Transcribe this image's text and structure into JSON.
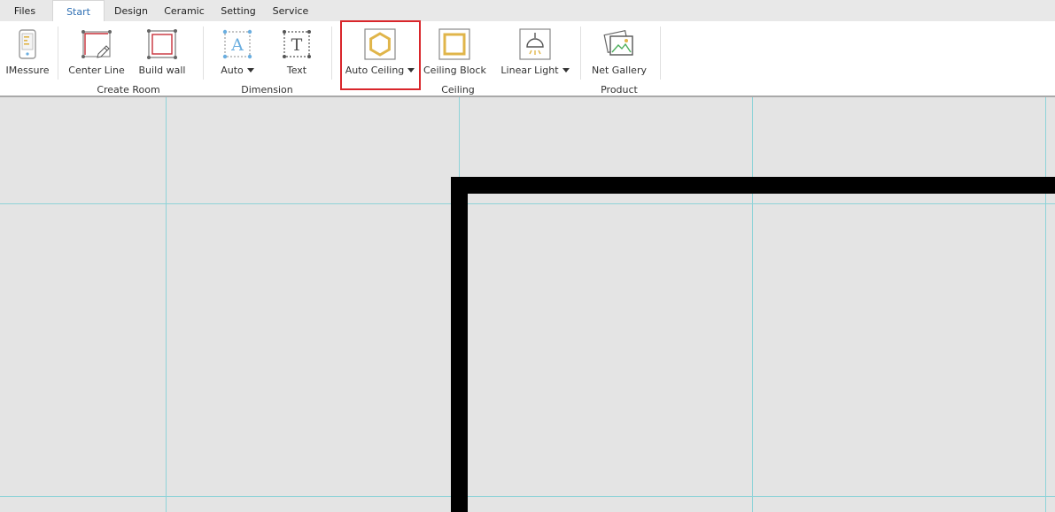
{
  "tabs": [
    {
      "label": "Files",
      "active": false
    },
    {
      "label": "Start",
      "active": true
    },
    {
      "label": "Design",
      "active": false
    },
    {
      "label": "Ceramic",
      "active": false
    },
    {
      "label": "Setting",
      "active": false
    },
    {
      "label": "Service",
      "active": false
    }
  ],
  "ribbon": {
    "tools": {
      "imessure": "IMessure",
      "center_line": "Center Line",
      "build_wall": "Build wall",
      "auto": "Auto",
      "text": "Text",
      "auto_ceiling": "Auto Ceiling",
      "ceiling_block": "Ceiling Block",
      "linear_light": "Linear Light",
      "net_gallery": "Net Gallery"
    },
    "groups": {
      "create_room": "Create Room",
      "dimension": "Dimension",
      "ceiling": "Ceiling",
      "product": "Product"
    },
    "highlighted_tool": "Auto Ceiling"
  },
  "colors": {
    "active_tab_text": "#2f6fb3",
    "highlight_border": "#d9262b",
    "gold_accent": "#e0b54a",
    "grid_line": "#8fd3d8",
    "wall": "#000000"
  }
}
